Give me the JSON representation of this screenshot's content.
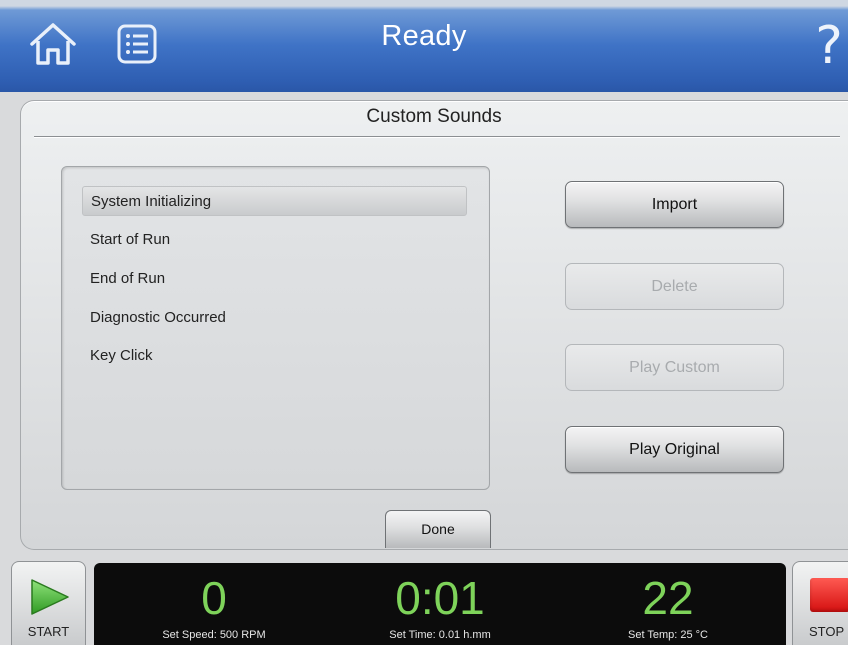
{
  "header": {
    "title": "Ready",
    "icons": {
      "home": "home-icon",
      "menu": "list-menu-icon",
      "help": "question-mark-icon"
    },
    "help_glyph": "?",
    "accent_color": "#2f5fb3"
  },
  "panel": {
    "title": "Custom Sounds",
    "list_items": [
      {
        "label": "System Initializing",
        "selected": true
      },
      {
        "label": "Start of Run",
        "selected": false
      },
      {
        "label": "End of Run",
        "selected": false
      },
      {
        "label": "Diagnostic Occurred",
        "selected": false
      },
      {
        "label": "Key Click",
        "selected": false
      }
    ],
    "buttons": {
      "import": {
        "label": "Import",
        "enabled": true
      },
      "delete": {
        "label": "Delete",
        "enabled": false
      },
      "play_custom": {
        "label": "Play Custom",
        "enabled": false
      },
      "play_original": {
        "label": "Play Original",
        "enabled": true
      }
    },
    "done_label": "Done"
  },
  "footer": {
    "start_label": "START",
    "stop_label": "STOP",
    "speed": {
      "value": "0",
      "label": "Set Speed: 500 RPM"
    },
    "time": {
      "value": "0:01",
      "label": "Set Time: 0.01 h.mm"
    },
    "temp": {
      "value": "22",
      "label": "Set Temp: 25 °C"
    },
    "readout_color": "#7ed35a",
    "start_icon_color": "#4caf3a",
    "stop_icon_color": "#e0201a"
  }
}
